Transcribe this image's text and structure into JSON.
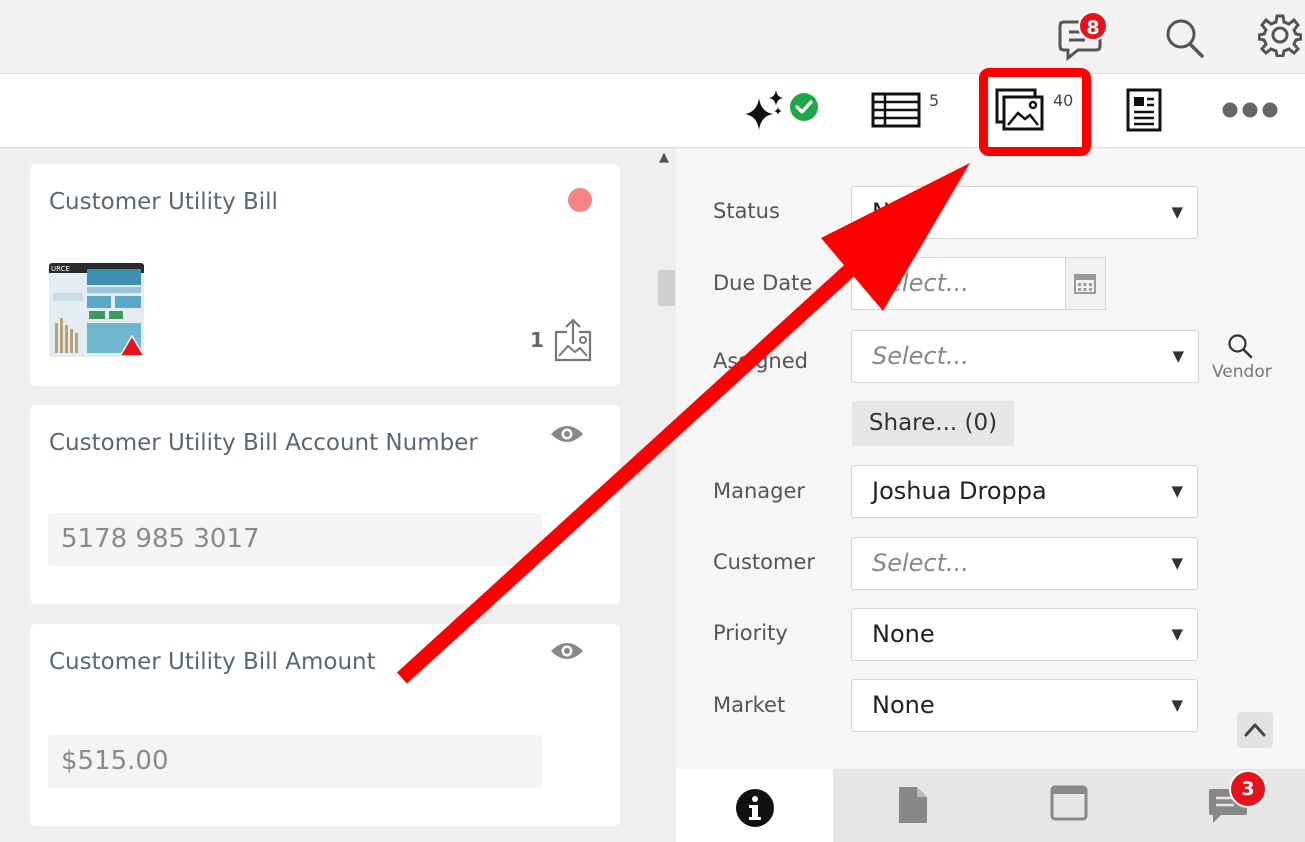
{
  "topbar": {
    "chat_badge": "8"
  },
  "toolbar": {
    "list_count": "5",
    "images_count": "40"
  },
  "cards": [
    {
      "title": "Customer Utility Bill",
      "attachment_count": "1"
    },
    {
      "title": "Customer Utility Bill Account Number",
      "value": "5178 985 3017"
    },
    {
      "title": "Customer Utility Bill Amount",
      "value": "$515.00"
    }
  ],
  "form": {
    "status": {
      "label": "Status",
      "value": "N"
    },
    "due_date": {
      "label": "Due Date",
      "placeholder": "Select..."
    },
    "assigned": {
      "label": "Assigned",
      "placeholder": "Select...",
      "vendor_label": "Vendor"
    },
    "share_button": "Share... (0)",
    "manager": {
      "label": "Manager",
      "value": "Joshua Droppa"
    },
    "customer": {
      "label": "Customer",
      "placeholder": "Select..."
    },
    "priority": {
      "label": "Priority",
      "value": "None"
    },
    "market": {
      "label": "Market",
      "value": "None"
    }
  },
  "bottom_tabs": {
    "comments_badge": "3"
  },
  "colors": {
    "badge": "#e8131a",
    "highlight": "#ff0000",
    "success": "#1fa84a",
    "status_dot": "#f78383"
  }
}
